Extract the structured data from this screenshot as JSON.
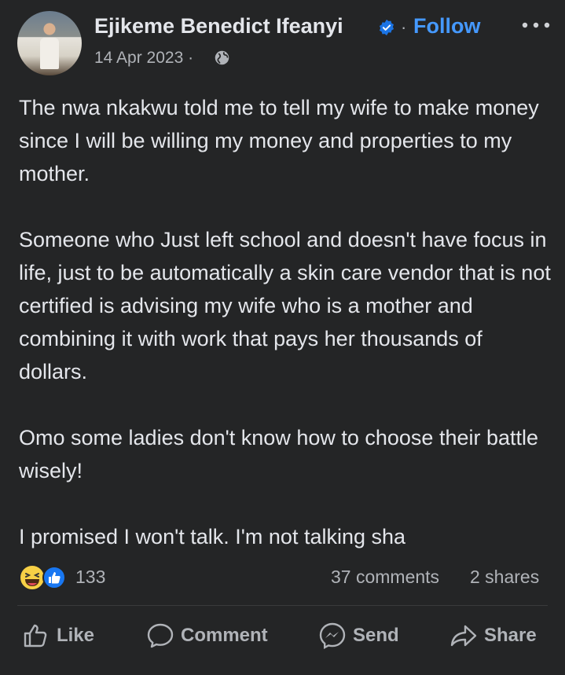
{
  "post": {
    "author": "Ejikeme Benedict Ifeanyi",
    "follow_label": "Follow",
    "separator": "·",
    "date": "14 Apr 2023 ·",
    "paragraphs": [
      "The nwa nkakwu told me to tell my wife to make money since I will be willing my money and properties to my mother.",
      "Someone who Just left school and doesn't have focus in life, just  to be automatically a skin care vendor that is not certified is advising my wife who is a mother and combining it with work that pays her thousands of dollars.",
      "Omo some ladies don't know how to choose their battle wisely!",
      "I  promised  I won't talk. I'm not talking sha"
    ]
  },
  "stats": {
    "reaction_count": "133",
    "comments": "37 comments",
    "shares": "2 shares"
  },
  "actions": {
    "like": "Like",
    "comment": "Comment",
    "send": "Send",
    "share": "Share"
  },
  "icons": [
    "avatar",
    "verified-badge-icon",
    "more-options-icon",
    "globe-icon",
    "haha-reaction-icon",
    "like-reaction-icon",
    "thumbs-up-icon",
    "comment-bubble-icon",
    "messenger-icon",
    "share-arrow-icon"
  ],
  "colors": {
    "background": "#242526",
    "text": "#e4e6eb",
    "muted": "#b0b3b8",
    "link": "#4599ff"
  }
}
